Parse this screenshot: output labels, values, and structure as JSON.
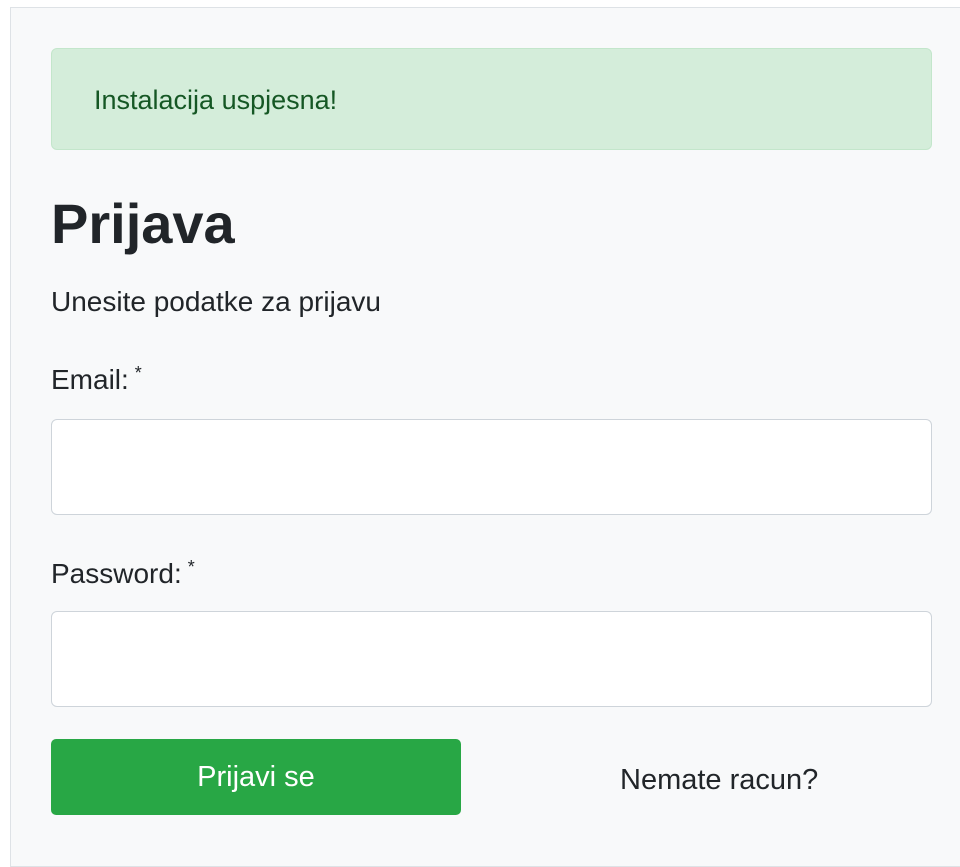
{
  "alert": {
    "message": "Instalacija uspjesna!",
    "background_color": "#d4edda",
    "text_color": "#155724"
  },
  "form": {
    "title": "Prijava",
    "subtitle": "Unesite podatke za prijavu",
    "email": {
      "label": "Email:",
      "required_marker": "*",
      "value": "",
      "placeholder": ""
    },
    "password": {
      "label": "Password:",
      "required_marker": "*",
      "value": "",
      "placeholder": ""
    },
    "submit_label": "Prijavi se",
    "submit_color": "#28a745",
    "register_link": "Nemate racun?"
  }
}
